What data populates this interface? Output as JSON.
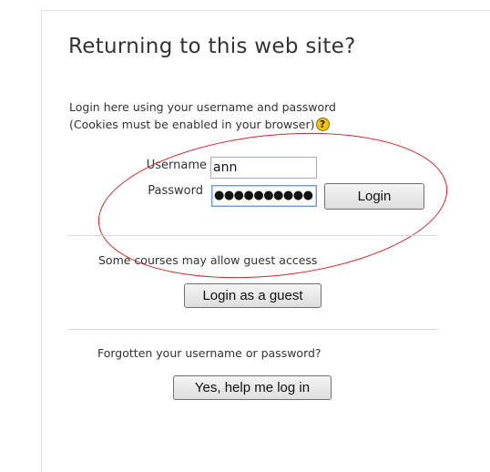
{
  "login": {
    "heading": "Returning to this web site?",
    "description_line1": "Login here using your username and password",
    "description_line2": "(Cookies must be enabled in your browser)",
    "help_icon_glyph": "?",
    "username_label": "Username",
    "username_value": "ann",
    "password_label": "Password",
    "password_value": "●●●●●●●●●●",
    "login_button": "Login"
  },
  "guest": {
    "note": "Some courses may allow guest access",
    "button": "Login as a guest"
  },
  "forgot": {
    "note": "Forgotten your username or password?",
    "button": "Yes, help me log in"
  },
  "colors": {
    "annotation_oval": "#d8232a",
    "help_icon": "#f2c500"
  },
  "icons": {
    "help": "help-icon"
  }
}
